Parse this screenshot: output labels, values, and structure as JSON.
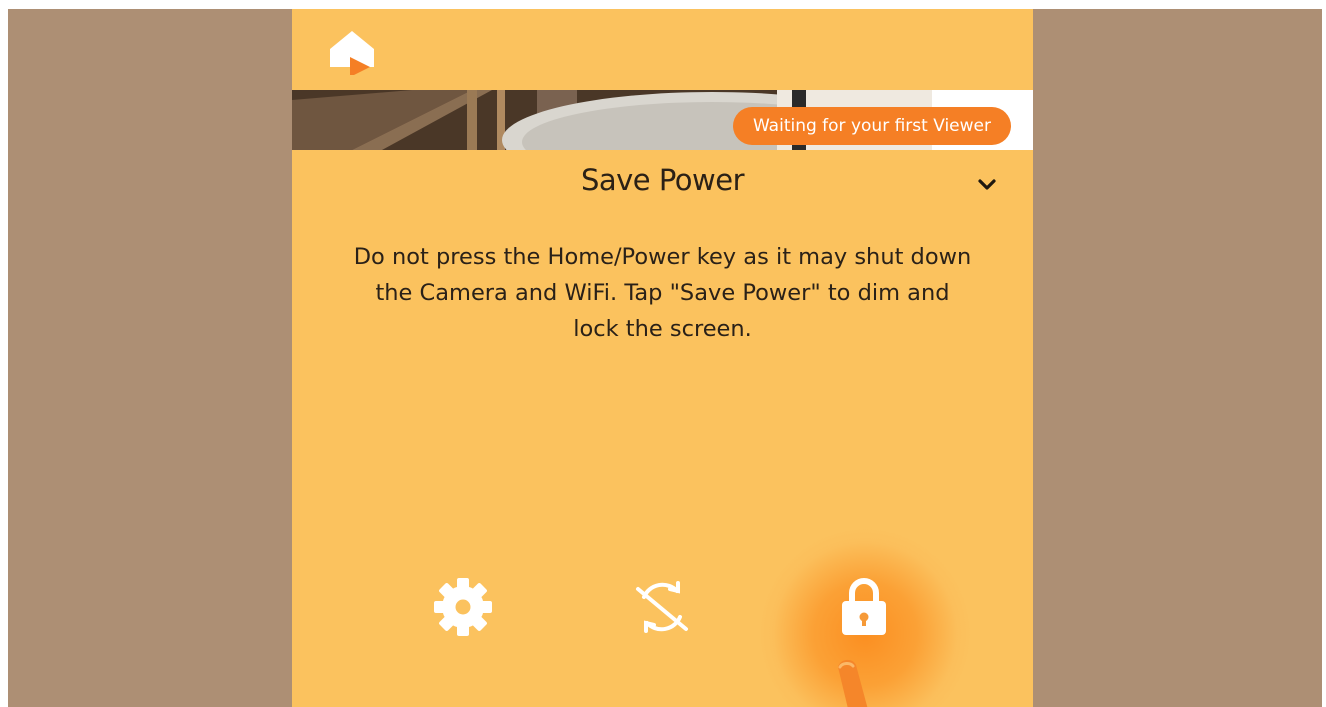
{
  "app": {
    "logo_icon": "home-camera-logo-icon"
  },
  "camera": {
    "badge_text": "Waiting for your first Viewer"
  },
  "mode": {
    "title": "Save Power",
    "dropdown_icon": "chevron-down-icon"
  },
  "instructions": {
    "text": "Do not press the Home/Power key as it may shut down the Camera and WiFi. Tap \"Save Power\" to dim and lock the screen."
  },
  "actions": [
    {
      "icon": "gear-icon"
    },
    {
      "icon": "rotation-lock-off-icon"
    },
    {
      "icon": "lock-icon"
    }
  ],
  "colors": {
    "backdrop": "#ad8f74",
    "panel": "#fbc25e",
    "accent": "#f57f25",
    "text": "#2b2116"
  }
}
